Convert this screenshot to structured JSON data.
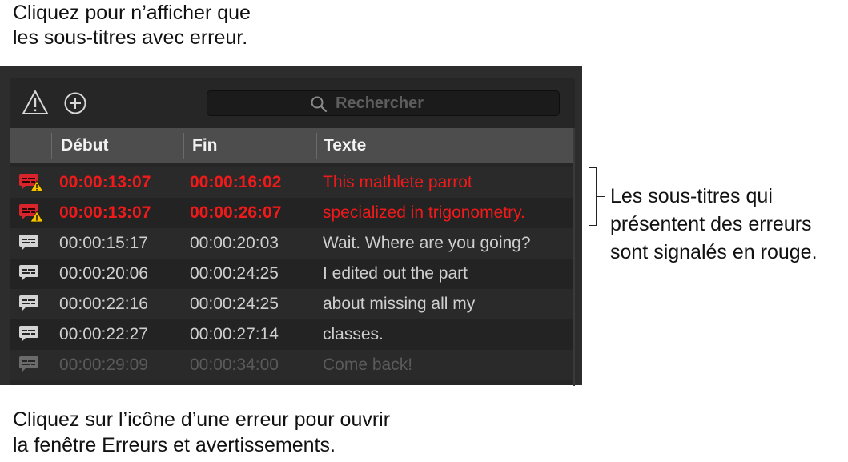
{
  "callouts": {
    "filter_line1": "Cliquez pour n’afficher que",
    "filter_line2": "les sous-titres avec erreur.",
    "red_line1": "Les sous-titres qui",
    "red_line2": "présentent des erreurs",
    "red_line3": "sont signalés en rouge.",
    "icon_line1": "Cliquez sur l’icône d’une erreur pour ouvrir",
    "icon_line2": "la fenêtre Erreurs et avertissements."
  },
  "search": {
    "placeholder": "Rechercher"
  },
  "table": {
    "headers": {
      "start": "Début",
      "end": "Fin",
      "text": "Texte"
    },
    "rows": [
      {
        "start": "00:00:13:07",
        "end": "00:00:16:02",
        "text": "This mathlete parrot",
        "status": "error"
      },
      {
        "start": "00:00:13:07",
        "end": "00:00:26:07",
        "text": "specialized in trigonometry.",
        "status": "error"
      },
      {
        "start": "00:00:15:17",
        "end": "00:00:20:03",
        "text": "Wait. Where are you going?",
        "status": "normal"
      },
      {
        "start": "00:00:20:06",
        "end": "00:00:24:25",
        "text": "I edited out the part",
        "status": "normal"
      },
      {
        "start": "00:00:22:16",
        "end": "00:00:24:25",
        "text": "about missing all my",
        "status": "normal"
      },
      {
        "start": "00:00:22:27",
        "end": "00:00:27:14",
        "text": "classes.",
        "status": "normal"
      },
      {
        "start": "00:00:29:09",
        "end": "00:00:34:00",
        "text": "Come back!",
        "status": "dim"
      }
    ]
  },
  "colors": {
    "error": "#f01a1a",
    "warning": "#f5c400",
    "panel": "#262626"
  },
  "icons": {
    "filter": "warning-triangle-icon",
    "add": "plus-circle-icon",
    "search": "search-icon",
    "caption": "caption-bubble-icon"
  }
}
